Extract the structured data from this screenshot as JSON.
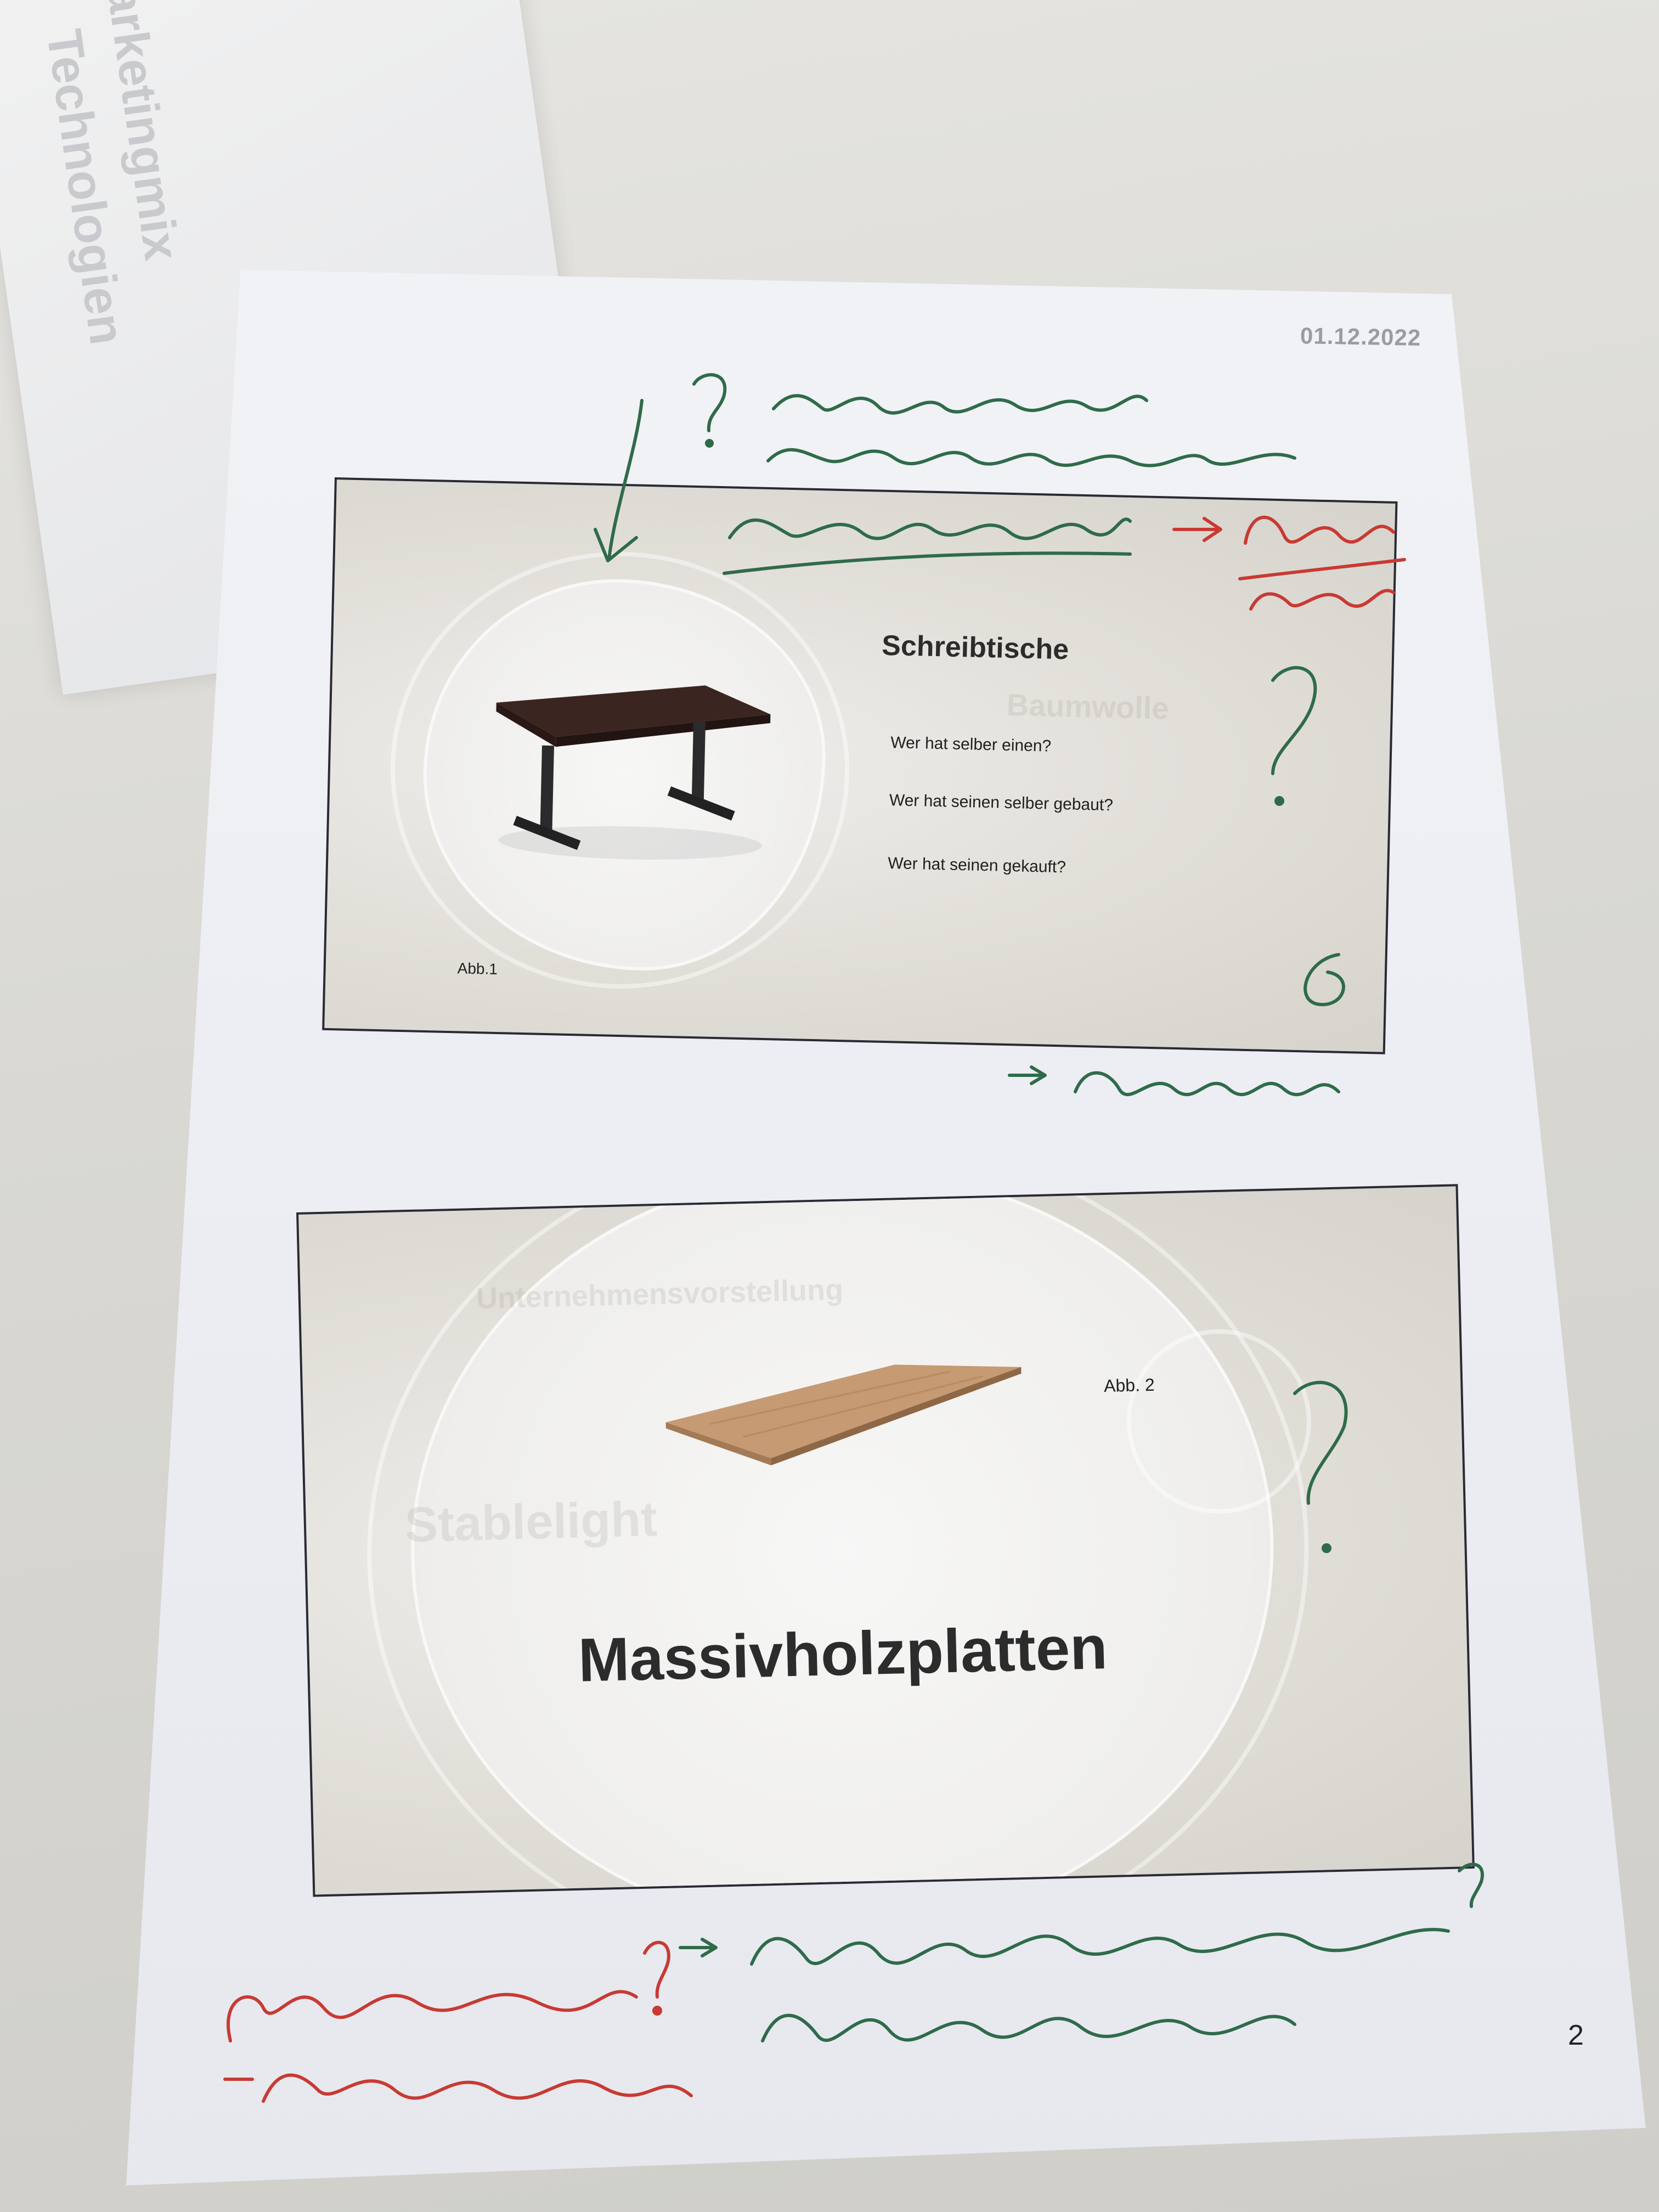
{
  "page": {
    "date": "01.12.2022",
    "number": "2"
  },
  "slide1": {
    "title": "Schreibtische",
    "questions": [
      "Wer hat selber einen?",
      "Wer hat seinen selber gebaut?",
      "Wer hat seinen gekauft?"
    ],
    "caption": "Abb.1"
  },
  "slide2": {
    "title": "Massivholzplatten",
    "caption": "Abb. 2"
  },
  "colors": {
    "ink_green": "#2f6b4a",
    "ink_red": "#c83a33"
  },
  "icons": [
    "desk-image",
    "wood-board-image"
  ]
}
